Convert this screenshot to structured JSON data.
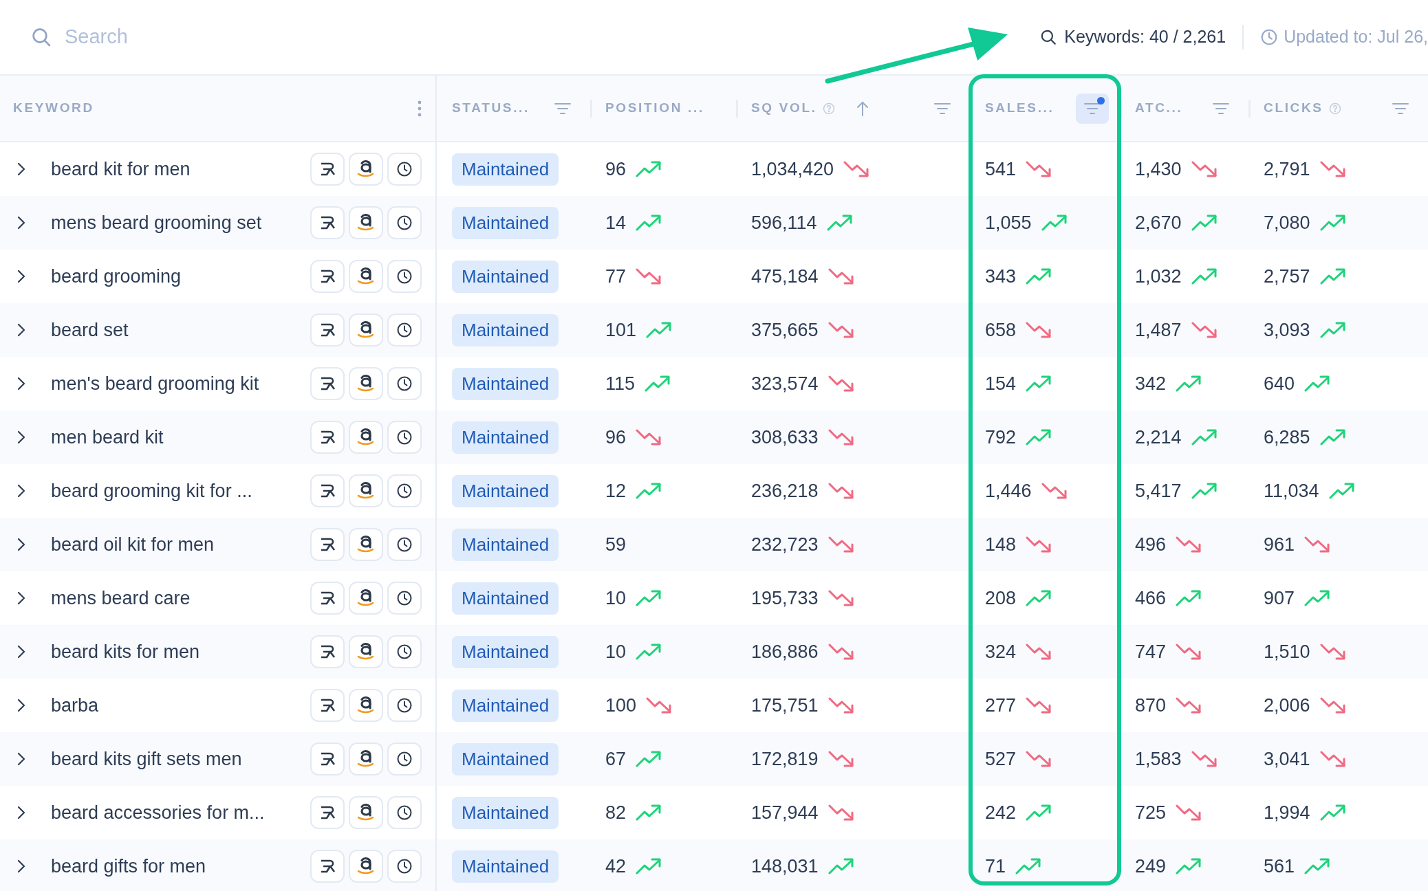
{
  "search": {
    "placeholder": "Search"
  },
  "keywords_count": "Keywords: 40 / 2,261",
  "updated": "Updated to: Jul 26,",
  "columns": [
    {
      "label": "KEYWORD",
      "highlighted": false,
      "controls": [
        {
          "kind": "menu"
        }
      ]
    },
    {
      "label": "STATUS...",
      "highlighted": false,
      "controls": [
        {
          "kind": "filter",
          "active": false
        }
      ]
    },
    {
      "label": "POSITION ...",
      "highlighted": false
    },
    {
      "label": "SQ VOL.",
      "highlighted": false,
      "controls": [
        {
          "kind": "help"
        },
        {
          "kind": "sort_up"
        },
        {
          "kind": "filter",
          "active": false
        }
      ]
    },
    {
      "label": "SALES...",
      "highlighted": true,
      "controls": [
        {
          "kind": "filter",
          "active": true
        }
      ]
    },
    {
      "label": "ATC...",
      "highlighted": false,
      "controls": [
        {
          "kind": "filter",
          "active": false
        }
      ]
    },
    {
      "label": "CLICKS",
      "highlighted": false,
      "controls": [
        {
          "kind": "help"
        },
        {
          "kind": "filter",
          "active": false
        }
      ]
    }
  ],
  "rows": [
    {
      "keyword": "beard kit for men",
      "status": "Maintained",
      "cells": [
        {
          "v": "96",
          "kind": "rising"
        },
        {
          "v": "1,034,420",
          "kind": "falling"
        },
        {
          "v": "541",
          "kind": "falling"
        },
        {
          "v": "1,430",
          "kind": "falling"
        },
        {
          "v": "2,791",
          "kind": "falling"
        }
      ]
    },
    {
      "keyword": "mens beard grooming set",
      "status": "Maintained",
      "cells": [
        {
          "v": "14",
          "kind": "rising"
        },
        {
          "v": "596,114",
          "kind": "rising"
        },
        {
          "v": "1,055",
          "kind": "rising"
        },
        {
          "v": "2,670",
          "kind": "rising"
        },
        {
          "v": "7,080",
          "kind": "rising"
        }
      ]
    },
    {
      "keyword": "beard grooming",
      "status": "Maintained",
      "cells": [
        {
          "v": "77",
          "kind": "falling"
        },
        {
          "v": "475,184",
          "kind": "falling"
        },
        {
          "v": "343",
          "kind": "rising"
        },
        {
          "v": "1,032",
          "kind": "rising"
        },
        {
          "v": "2,757",
          "kind": "rising"
        }
      ]
    },
    {
      "keyword": "beard set",
      "status": "Maintained",
      "cells": [
        {
          "v": "101",
          "kind": "rising"
        },
        {
          "v": "375,665",
          "kind": "falling"
        },
        {
          "v": "658",
          "kind": "falling"
        },
        {
          "v": "1,487",
          "kind": "falling"
        },
        {
          "v": "3,093",
          "kind": "rising"
        }
      ]
    },
    {
      "keyword": "men's beard grooming kit",
      "status": "Maintained",
      "cells": [
        {
          "v": "115",
          "kind": "rising"
        },
        {
          "v": "323,574",
          "kind": "falling"
        },
        {
          "v": "154",
          "kind": "rising"
        },
        {
          "v": "342",
          "kind": "rising"
        },
        {
          "v": "640",
          "kind": "rising"
        }
      ]
    },
    {
      "keyword": "men beard kit",
      "status": "Maintained",
      "cells": [
        {
          "v": "96",
          "kind": "falling"
        },
        {
          "v": "308,633",
          "kind": "falling"
        },
        {
          "v": "792",
          "kind": "rising"
        },
        {
          "v": "2,214",
          "kind": "rising"
        },
        {
          "v": "6,285",
          "kind": "rising"
        }
      ]
    },
    {
      "keyword": "beard grooming kit for ...",
      "status": "Maintained",
      "cells": [
        {
          "v": "12",
          "kind": "rising"
        },
        {
          "v": "236,218",
          "kind": "falling"
        },
        {
          "v": "1,446",
          "kind": "falling"
        },
        {
          "v": "5,417",
          "kind": "rising"
        },
        {
          "v": "11,034",
          "kind": "rising"
        }
      ]
    },
    {
      "keyword": "beard oil kit for men",
      "status": "Maintained",
      "cells": [
        {
          "v": "59",
          "kind": "plain"
        },
        {
          "v": "232,723",
          "kind": "falling"
        },
        {
          "v": "148",
          "kind": "falling"
        },
        {
          "v": "496",
          "kind": "falling"
        },
        {
          "v": "961",
          "kind": "falling"
        }
      ]
    },
    {
      "keyword": "mens beard care",
      "status": "Maintained",
      "cells": [
        {
          "v": "10",
          "kind": "rising"
        },
        {
          "v": "195,733",
          "kind": "falling"
        },
        {
          "v": "208",
          "kind": "rising"
        },
        {
          "v": "466",
          "kind": "rising"
        },
        {
          "v": "907",
          "kind": "rising"
        }
      ]
    },
    {
      "keyword": "beard kits for men",
      "status": "Maintained",
      "cells": [
        {
          "v": "10",
          "kind": "rising"
        },
        {
          "v": "186,886",
          "kind": "falling"
        },
        {
          "v": "324",
          "kind": "falling"
        },
        {
          "v": "747",
          "kind": "falling"
        },
        {
          "v": "1,510",
          "kind": "falling"
        }
      ]
    },
    {
      "keyword": "barba",
      "status": "Maintained",
      "cells": [
        {
          "v": "100",
          "kind": "falling"
        },
        {
          "v": "175,751",
          "kind": "falling"
        },
        {
          "v": "277",
          "kind": "falling"
        },
        {
          "v": "870",
          "kind": "falling"
        },
        {
          "v": "2,006",
          "kind": "falling"
        }
      ]
    },
    {
      "keyword": "beard kits gift sets men",
      "status": "Maintained",
      "cells": [
        {
          "v": "67",
          "kind": "rising"
        },
        {
          "v": "172,819",
          "kind": "falling"
        },
        {
          "v": "527",
          "kind": "falling"
        },
        {
          "v": "1,583",
          "kind": "falling"
        },
        {
          "v": "3,041",
          "kind": "falling"
        }
      ]
    },
    {
      "keyword": "beard accessories for m...",
      "status": "Maintained",
      "cells": [
        {
          "v": "82",
          "kind": "rising"
        },
        {
          "v": "157,944",
          "kind": "falling"
        },
        {
          "v": "242",
          "kind": "rising"
        },
        {
          "v": "725",
          "kind": "falling"
        },
        {
          "v": "1,994",
          "kind": "rising"
        }
      ]
    },
    {
      "keyword": "beard gifts for men",
      "status": "Maintained",
      "cells": [
        {
          "v": "42",
          "kind": "rising"
        },
        {
          "v": "148,031",
          "kind": "rising"
        },
        {
          "v": "71",
          "kind": "rising"
        },
        {
          "v": "249",
          "kind": "rising"
        },
        {
          "v": "561",
          "kind": "rising"
        }
      ]
    }
  ]
}
